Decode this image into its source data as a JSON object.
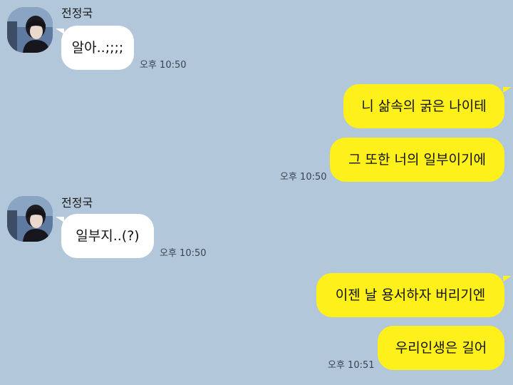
{
  "colors": {
    "background": "#b2c7d9",
    "incoming_bubble": "#ffffff",
    "outgoing_bubble": "#fef01b"
  },
  "messages": [
    {
      "direction": "incoming",
      "sender": "전정국",
      "text": "알아..;;;;",
      "time": "오후 10:50"
    },
    {
      "direction": "outgoing",
      "text": "니 삶속의 굵은 나이테"
    },
    {
      "direction": "outgoing",
      "text": "그 또한 너의 일부이기에",
      "time": "오후 10:50"
    },
    {
      "direction": "incoming",
      "sender": "전정국",
      "text": "일부지..(?)",
      "time": "오후 10:50"
    },
    {
      "direction": "outgoing",
      "text": "이젠 날 용서하자 버리기엔"
    },
    {
      "direction": "outgoing",
      "text": "우리인생은 길어",
      "time": "오후 10:51"
    }
  ]
}
